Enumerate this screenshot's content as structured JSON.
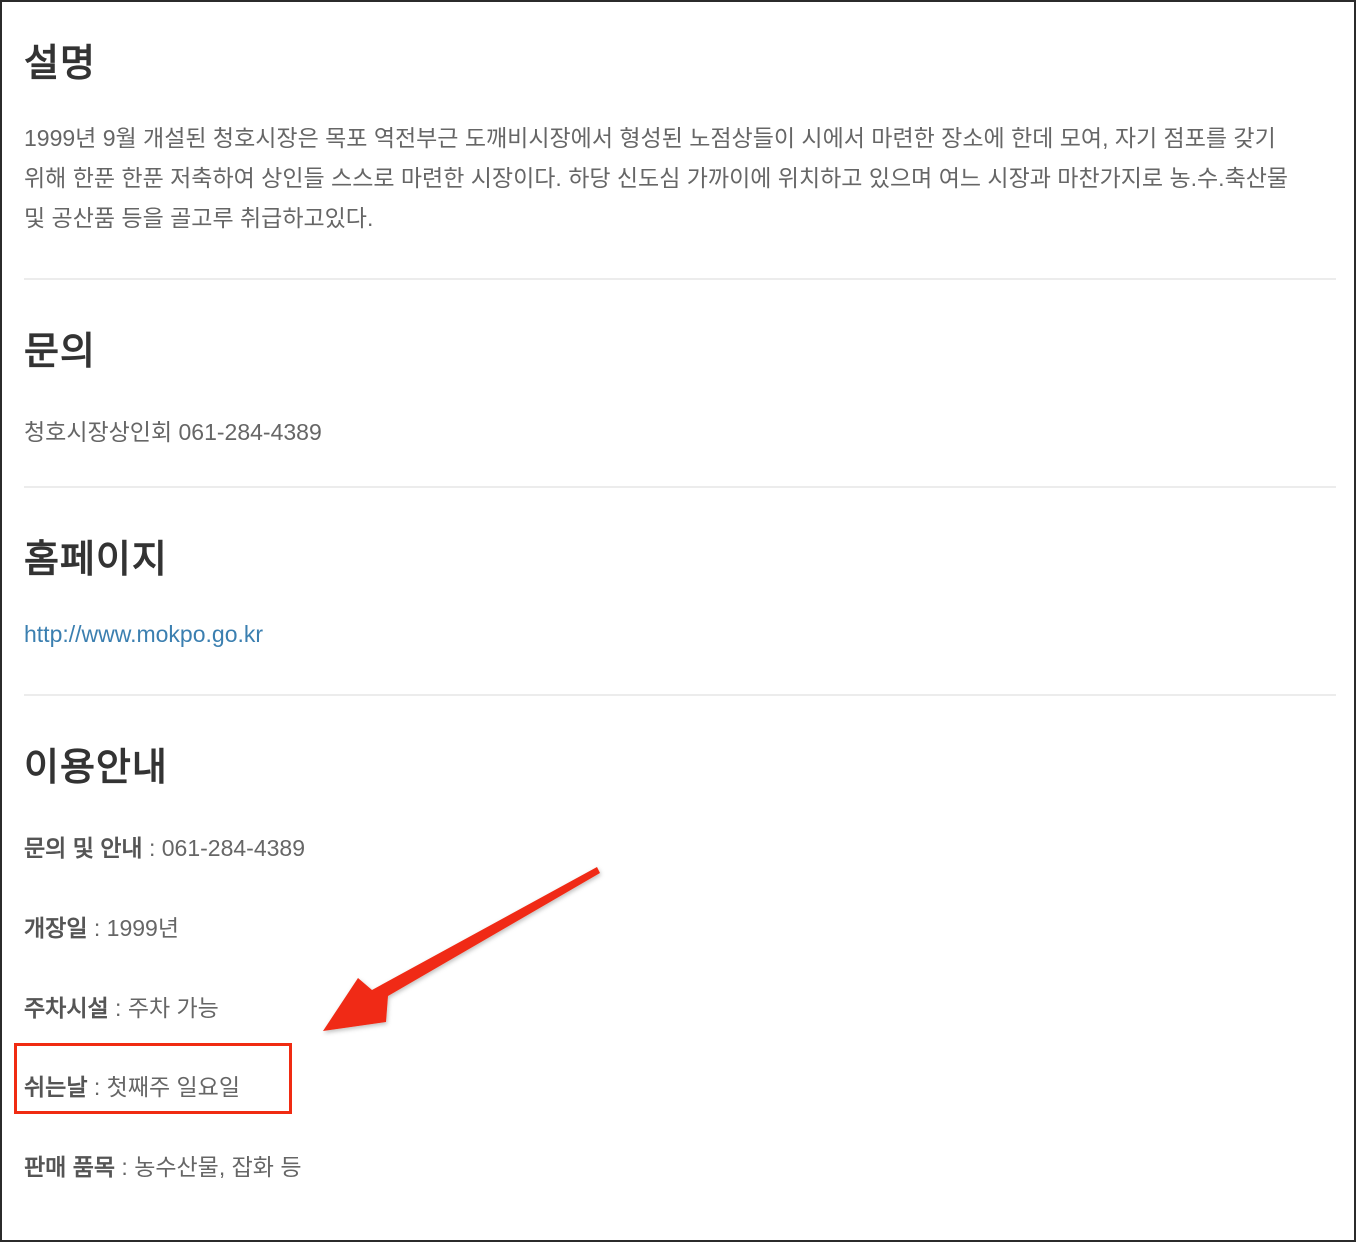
{
  "sections": {
    "description": {
      "heading": "설명",
      "line1": "1999년 9월 개설된 청호시장은 목포 역전부근 도깨비시장에서 형성된 노점상들이 시에서 마련한 장소에 한데 모여, 자기 점포를 갖기",
      "line2": "위해 한푼 한푼 저축하여 상인들 스스로 마련한 시장이다. 하당 신도심 가까이에 위치하고 있으며 여느 시장과 마찬가지로 농.수.축산물",
      "line3": "및 공산품 등을 골고루 취급하고있다."
    },
    "contact": {
      "heading": "문의",
      "text": "청호시장상인회 061-284-4389"
    },
    "homepage": {
      "heading": "홈페이지",
      "url": "http://www.mokpo.go.kr"
    },
    "usage": {
      "heading": "이용안내",
      "items": [
        {
          "key": "문의 및 안내",
          "sep": " : ",
          "value": "061-284-4389"
        },
        {
          "key": "개장일",
          "sep": " : ",
          "value": "1999년"
        },
        {
          "key": "주차시설",
          "sep": " : ",
          "value": "주차 가능"
        },
        {
          "key": "쉬는날",
          "sep": " : ",
          "value": "첫째주 일요일"
        },
        {
          "key": "판매 품목",
          "sep": " : ",
          "value": "농수산물, 잡화 등"
        }
      ]
    }
  },
  "annotation": {
    "color": "#f02b12",
    "highlighted_item": "쉬는날"
  }
}
